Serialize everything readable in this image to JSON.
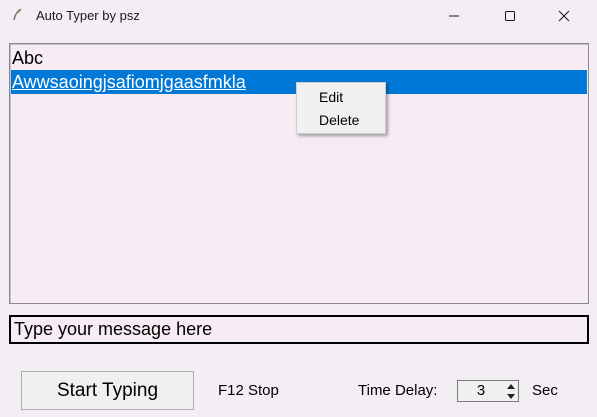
{
  "window": {
    "title": "Auto Typer by psz",
    "icons": {
      "app": "feather-pen-icon",
      "minimize": "minimize-icon",
      "maximize": "maximize-icon",
      "close": "close-icon"
    }
  },
  "list": {
    "items": [
      {
        "text": "Abc",
        "selected": false
      },
      {
        "text": "Awwsaoingjsafiomjgaasfmkla",
        "selected": true
      }
    ]
  },
  "context_menu": {
    "items": [
      "Edit",
      "Delete"
    ]
  },
  "input": {
    "value": "",
    "placeholder": "Type your message here"
  },
  "controls": {
    "start_label": "Start Typing",
    "stop_hint": "F12 Stop",
    "delay_label": "Time Delay:",
    "delay_value": "3",
    "delay_unit": "Sec"
  },
  "colors": {
    "selection": "#0078d7",
    "window_bg": "#f3eef4",
    "list_bg": "#f7ebf4"
  }
}
